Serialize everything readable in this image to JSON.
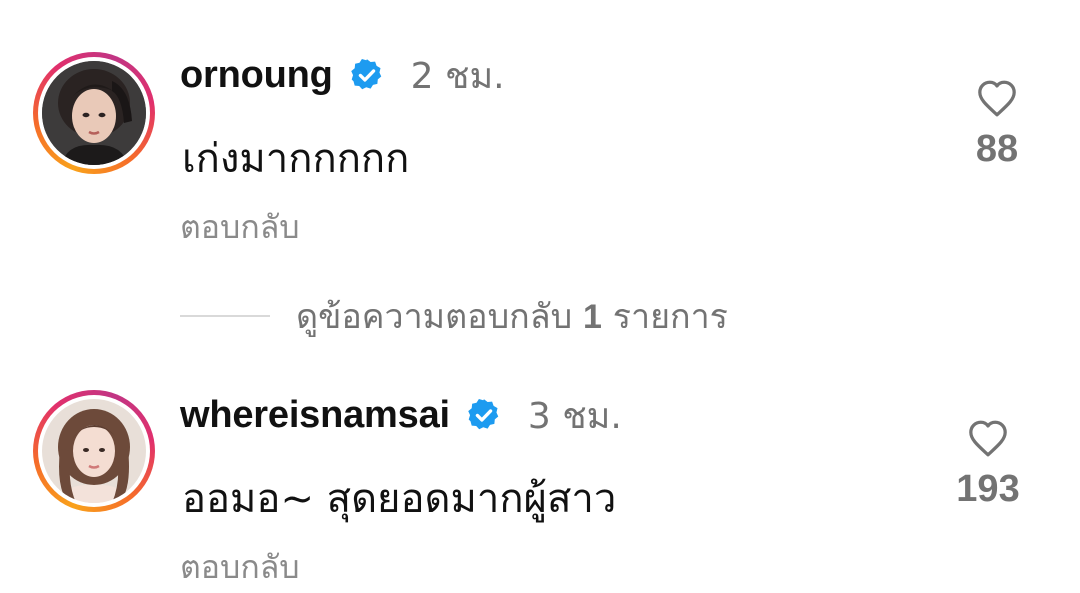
{
  "comments": [
    {
      "username": "ornoung",
      "verified": true,
      "time": "2 ชม.",
      "text": "เก่งมากกกกก",
      "reply_label": "ตอบกลับ",
      "likes": "88",
      "avatar_icon": "profile-photo"
    },
    {
      "username": "whereisnamsai",
      "verified": true,
      "time": "3 ชม.",
      "text": "ออมอ~ สุดยอดมากผู้สาว",
      "reply_label": "ตอบกลับ",
      "likes": "193",
      "avatar_icon": "profile-photo"
    }
  ],
  "view_replies": {
    "prefix": "ดูข้อความตอบกลับ",
    "count": "1",
    "suffix": "รายการ"
  },
  "colors": {
    "verified": "#1d9bf0",
    "secondary_text": "#737373",
    "story_ring": [
      "#f9a21b",
      "#e1306c",
      "#c13584"
    ]
  }
}
